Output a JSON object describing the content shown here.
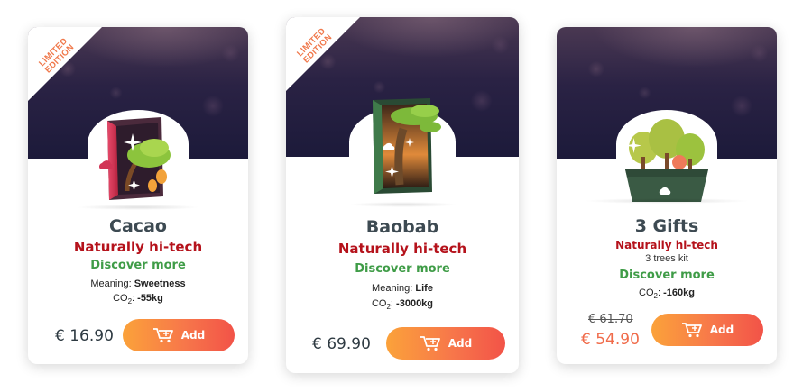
{
  "products": [
    {
      "ribbon": "LIMITED EDITION",
      "name": "Cacao",
      "tagline": "Naturally hi-tech",
      "discover": "Discover more",
      "meaning_label": "Meaning:",
      "meaning_value": "Sweetness",
      "co2_value": "-55kg",
      "price": "€ 16.90",
      "add_label": "Add",
      "art_icon": "cacao-tree-box-icon"
    },
    {
      "ribbon": "LIMITED EDITION",
      "name": "Baobab",
      "tagline": "Naturally hi-tech",
      "discover": "Discover more",
      "meaning_label": "Meaning:",
      "meaning_value": "Life",
      "co2_value": "-3000kg",
      "price": "€ 69.90",
      "add_label": "Add",
      "art_icon": "baobab-tree-box-icon"
    },
    {
      "name": "3 Gifts",
      "tagline": "Naturally hi-tech",
      "subtitle": "3 trees kit",
      "discover": "Discover more",
      "co2_value": "-160kg",
      "old_price": "€ 61.70",
      "price": "€ 54.90",
      "add_label": "Add",
      "art_icon": "gift-trees-kit-icon"
    }
  ],
  "co2_label": "CO",
  "co2_sub": "2",
  "co2_colon": ":",
  "colors": {
    "tagline": "#b5121b",
    "discover": "#3f9c47",
    "ribbon": "#f0794c",
    "button_start": "#fba23a",
    "button_end": "#f25348",
    "sale_price": "#f06b4a"
  }
}
